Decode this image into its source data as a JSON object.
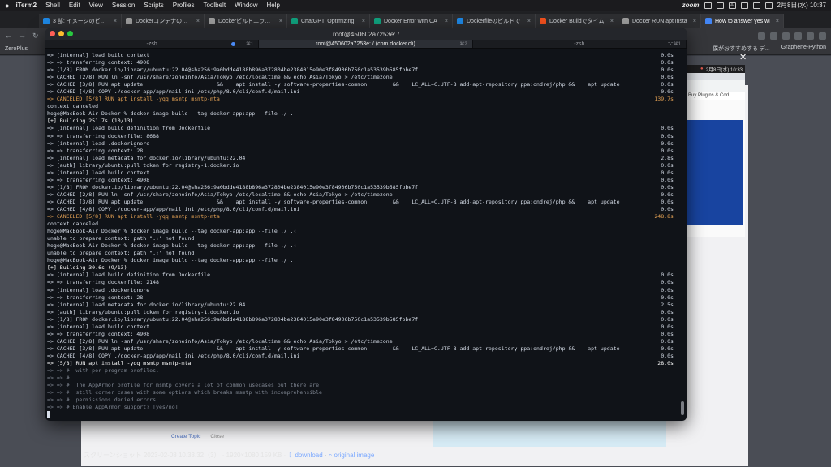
{
  "menubar": {
    "app": "iTerm2",
    "items": [
      "Shell",
      "Edit",
      "View",
      "Session",
      "Scripts",
      "Profiles",
      "Toolbelt",
      "Window",
      "Help"
    ],
    "zoom": "zoom",
    "input_indicator": "A",
    "clock": "2月8日(水) 10:37"
  },
  "chrome": {
    "tabs": [
      {
        "title": "3 部: イメージのビルド",
        "color": "#1e88e5"
      },
      {
        "title": "Dockerコンテナのビル",
        "color": "#9e9e9e"
      },
      {
        "title": "Dockerビルドエラー解",
        "color": "#9e9e9e"
      },
      {
        "title": "ChatGPT: Optimizing",
        "color": "#10a37f"
      },
      {
        "title": "Docker Error with CA",
        "color": "#10a37f"
      },
      {
        "title": "Dockerfileのビルドで",
        "color": "#1e88e5"
      },
      {
        "title": "Docker Buildでタイム",
        "color": "#f4511e"
      },
      {
        "title": "Docker RUN apt insta",
        "color": "#9e9e9e"
      },
      {
        "title": "How to answer yes wi",
        "color": "#4285f4",
        "active": true
      }
    ],
    "bookmarks_left": "ZeroPlus",
    "bookmarks_right": [
      "僕がおすすめする デ...",
      "Graphene-Python"
    ],
    "nested": {
      "date": "2月8日(水) 10:33",
      "label": "Buy Plugins & Cod..."
    },
    "footer": {
      "prefix": "スクリーンショット 2023-02-08 10.33.32（3） · 1920×1080 159 KB · ",
      "download": "download",
      "original": "original image"
    },
    "topic_create": "Create Topic",
    "topic_close": "Close"
  },
  "iterm": {
    "title": "root@450602a7253e: /",
    "tabs": [
      {
        "label": "-zsh",
        "shortcut": "⌘1",
        "dot": true
      },
      {
        "label": "root@450602a7253e: / (com.docker.cli)",
        "shortcut": "⌘2",
        "active": true
      },
      {
        "label": "-zsh",
        "shortcut": "⌥⌘1"
      }
    ],
    "lines": [
      {
        "t": "=> [internal] load build context",
        "time": "0.0s"
      },
      {
        "t": "=> => transferring context: 4908",
        "time": "0.0s"
      },
      {
        "t": "=> [1/8] FROM docker.io/library/ubuntu:22.04@sha256:9a0bdde4188b896a372804be2384015e90e3f84906b750c1a53539b585fbbe7f",
        "time": "0.0s"
      },
      {
        "t": "=> CACHED [2/8] RUN ln -snf /usr/share/zoneinfo/Asia/Tokyo /etc/localtime && echo Asia/Tokyo > /etc/timezone",
        "time": "0.0s"
      },
      {
        "t": "=> CACHED [3/8] RUN apt update                       &&    apt install -y software-properties-common        &&    LC_ALL=C.UTF-8 add-apt-repository ppa:ondrej/php &&    apt update",
        "time": "0.0s"
      },
      {
        "t": "=> CACHED [4/8] COPY ./docker-app/app/mail.ini /etc/php/8.0/cli/conf.d/mail.ini",
        "time": "0.0s"
      },
      {
        "t": "=> CANCELED [5/8] RUN apt install -yqq msmtp msmtp-mta",
        "time": "139.7s",
        "c": "warn"
      },
      {
        "t": "context canceled"
      },
      {
        "t": "hoge@MacBook-Air Docker % docker image build --tag docker-app:app --file ./ ."
      },
      {
        "t": "[+] Building 251.7s (10/13)",
        "c": "bold"
      },
      {
        "t": "=> [internal] load build definition from Dockerfile",
        "time": "0.0s"
      },
      {
        "t": "=> => transferring dockerfile: 8688",
        "time": "0.0s"
      },
      {
        "t": "=> [internal] load .dockerignore",
        "time": "0.0s"
      },
      {
        "t": "=> => transferring context: 28",
        "time": "0.0s"
      },
      {
        "t": "=> [internal] load metadata for docker.io/library/ubuntu:22.04",
        "time": "2.8s"
      },
      {
        "t": "=> [auth] library/ubuntu:pull token for registry-1.docker.io",
        "time": "0.0s"
      },
      {
        "t": "=> [internal] load build context",
        "time": "0.0s"
      },
      {
        "t": "=> => transferring context: 4908",
        "time": "0.0s"
      },
      {
        "t": "=> [1/8] FROM docker.io/library/ubuntu:22.04@sha256:9a0bdde4188b896a372804be2384015e90e3f84906b750c1a53539b585fbbe7f",
        "time": "0.0s"
      },
      {
        "t": "=> CACHED [2/8] RUN ln -snf /usr/share/zoneinfo/Asia/Tokyo /etc/localtime && echo Asia/Tokyo > /etc/timezone",
        "time": "0.0s"
      },
      {
        "t": "=> CACHED [3/8] RUN apt update                       &&    apt install -y software-properties-common        &&    LC_ALL=C.UTF-8 add-apt-repository ppa:ondrej/php &&    apt update",
        "time": "0.0s"
      },
      {
        "t": "=> CACHED [4/8] COPY ./docker-app/app/mail.ini /etc/php/8.0/cli/conf.d/mail.ini",
        "time": "0.0s"
      },
      {
        "t": "=> CANCELED [5/8] RUN apt install -yqq msmtp msmtp-mta",
        "time": "248.8s",
        "c": "warn"
      },
      {
        "t": "context canceled"
      },
      {
        "t": "hoge@MacBook-Air Docker % docker image build --tag docker-app:app --file ./ .‹"
      },
      {
        "t": "unable to prepare context: path \".‹\" not found"
      },
      {
        "t": "hoge@MacBook-Air Docker % docker image build --tag docker-app:app --file ./ .‹"
      },
      {
        "t": "unable to prepare context: path \".‹\" not found"
      },
      {
        "t": "hoge@MacBook-Air Docker % docker image build --tag docker-app:app --file ./ ."
      },
      {
        "t": "[+] Building 30.6s (9/13)",
        "c": "bold"
      },
      {
        "t": "=> [internal] load build definition from Dockerfile",
        "time": "0.0s"
      },
      {
        "t": "=> => transferring dockerfile: 2148",
        "time": "0.0s"
      },
      {
        "t": "=> [internal] load .dockerignore",
        "time": "0.0s"
      },
      {
        "t": "=> => transferring context: 28",
        "time": "0.0s"
      },
      {
        "t": "=> [internal] load metadata for docker.io/library/ubuntu:22.04",
        "time": "2.5s"
      },
      {
        "t": "=> [auth] library/ubuntu:pull token for registry-1.docker.io",
        "time": "0.0s"
      },
      {
        "t": "=> [1/8] FROM docker.io/library/ubuntu:22.04@sha256:9a0bdde4188b896a372804be2384015e90e3f84906b750c1a53539b585fbbe7f",
        "time": "0.0s"
      },
      {
        "t": "=> [internal] load build context",
        "time": "0.0s"
      },
      {
        "t": "=> => transferring context: 4908",
        "time": "0.0s"
      },
      {
        "t": "=> CACHED [2/8] RUN ln -snf /usr/share/zoneinfo/Asia/Tokyo /etc/localtime && echo Asia/Tokyo > /etc/timezone",
        "time": "0.0s"
      },
      {
        "t": "=> CACHED [3/8] RUN apt update                       &&    apt install -y software-properties-common        &&    LC_ALL=C.UTF-8 add-apt-repository ppa:ondrej/php &&    apt update",
        "time": "0.0s"
      },
      {
        "t": "=> CACHED [4/8] COPY ./docker-app/app/mail.ini /etc/php/8.0/cli/conf.d/mail.ini",
        "time": "0.0s"
      },
      {
        "t": "=> [5/8] RUN apt install -yqq msmtp msmtp-mta",
        "time": "28.0s",
        "c": "bold"
      },
      {
        "t": "=> => #  with per-program profiles.",
        "c": "dim"
      },
      {
        "t": "=> => #",
        "c": "dim"
      },
      {
        "t": "=> => #  The AppArmor profile for msmtp covers a lot of common usecases but there are",
        "c": "dim"
      },
      {
        "t": "=> => #  still corner cases with some options which breaks msmtp with incomprehensible",
        "c": "dim"
      },
      {
        "t": "=> => #  permissions denied errors.",
        "c": "dim"
      },
      {
        "t": "=> => # Enable AppArmor support? [yes/no]",
        "c": "dim"
      }
    ]
  }
}
